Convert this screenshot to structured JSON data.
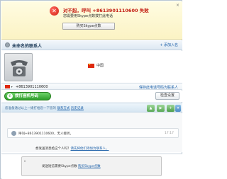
{
  "banner": {
    "title": "对不起，呼叫 +8613901110600 失败",
    "subtitle": "您需要用Skype点数拨打此电话",
    "buy_button": "购买Skype点数",
    "close_glyph": "×"
  },
  "contact": {
    "name": "未命名的联系人",
    "add_contact": "+ 添加入名",
    "country": "中国"
  },
  "phone": {
    "number": "+8613901110600",
    "save_link": "保存此电话号码为联系人"
  },
  "actions": {
    "call_button": "拨打座机号码",
    "settings_button": "检查设置"
  },
  "info_bar": {
    "text": "您准备通过以上一拨打给您一下您的",
    "link1": "联系方式",
    "link2": "历史记录"
  },
  "chat": {
    "message_text": "呼叫+8613901110600，无人接听。",
    "message_time": "17:17",
    "prompt_text": "想发送消息给这个人吗？",
    "prompt_link": "请先将他们添加为联系人。"
  },
  "input": {
    "sms_text": "发送短信需要Skype点数",
    "sms_link": "购买Skype点数"
  },
  "colors": {
    "error_red": "#c21a10",
    "call_green": "#2e9e2a",
    "link_blue": "#1b5fa8"
  },
  "icons": {
    "error": "error-x-icon",
    "call": "phone-icon",
    "avatar": "telephone-avatar-icon"
  }
}
